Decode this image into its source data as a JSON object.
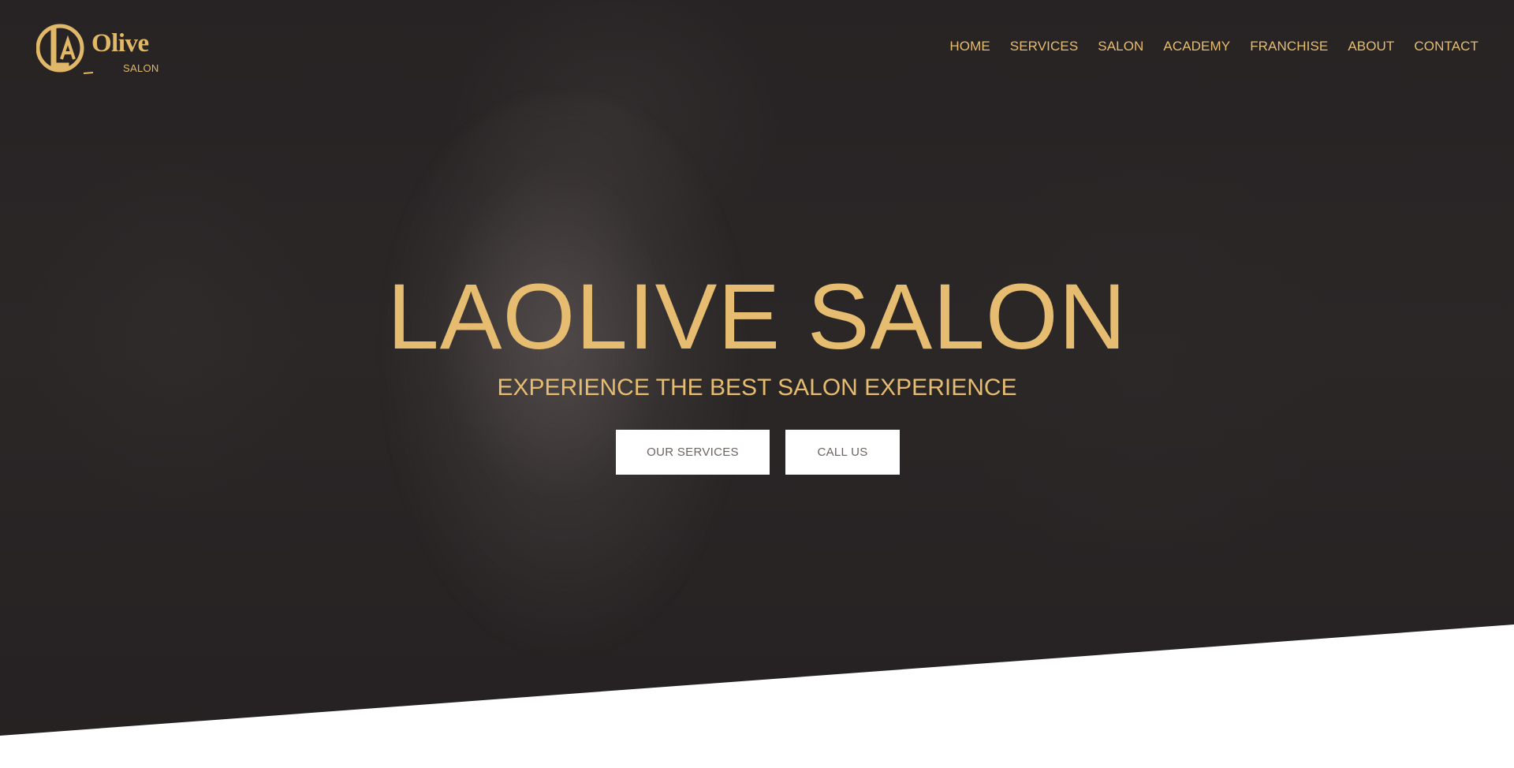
{
  "brand": {
    "logo_initial": "L",
    "logo_name": "Olive",
    "logo_sub": "SALON",
    "accent_color": "#e6bd70"
  },
  "nav": {
    "items": [
      {
        "label": "HOME"
      },
      {
        "label": "SERVICES"
      },
      {
        "label": "SALON"
      },
      {
        "label": "ACADEMY"
      },
      {
        "label": "FRANCHISE"
      },
      {
        "label": "ABOUT"
      },
      {
        "label": "CONTACT"
      }
    ]
  },
  "hero": {
    "title": "LAOLIVE SALON",
    "subtitle": "EXPERIENCE THE BEST SALON EXPERIENCE",
    "buttons": {
      "services_label": "OUR SERVICES",
      "call_label": "CALL US"
    }
  }
}
